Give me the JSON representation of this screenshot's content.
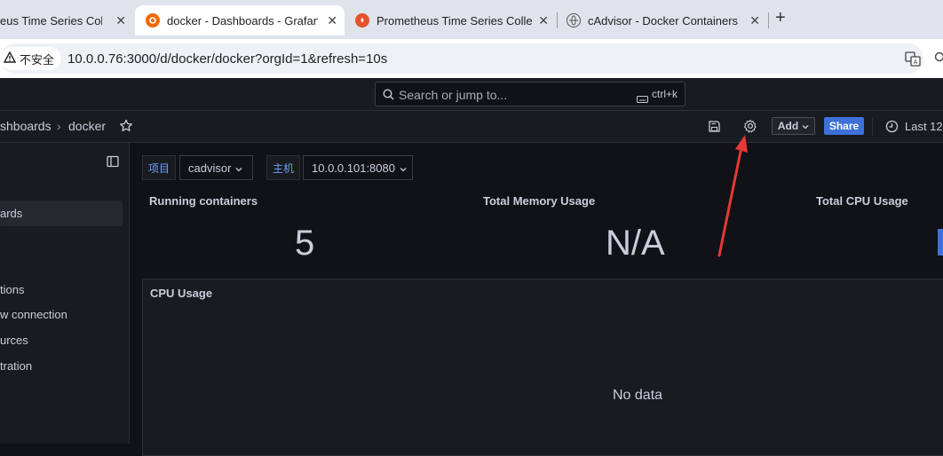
{
  "browser": {
    "tabs": [
      {
        "label": "eus Time Series Colle",
        "active": false
      },
      {
        "label": "docker - Dashboards - Grafan",
        "active": true
      },
      {
        "label": "Prometheus Time Series Colle",
        "active": false
      },
      {
        "label": "cAdvisor - Docker Containers",
        "active": false
      }
    ],
    "new_tab": "+",
    "security_label": "不安全",
    "url": "10.0.0.76:3000/d/docker/docker?orgId=1&refresh=10s"
  },
  "grafana": {
    "search_placeholder": "Search or jump to...",
    "search_shortcut": "ctrl+k",
    "breadcrumb": {
      "parent": "shboards",
      "separator": "›",
      "current": "docker"
    },
    "toolbar": {
      "add_label": "Add",
      "share_label": "Share",
      "time_label": "Last 12"
    },
    "sidebar": {
      "items": [
        {
          "label": "ards",
          "active": true
        },
        {
          "label": "tions",
          "active": false
        },
        {
          "label": "w connection",
          "active": false
        },
        {
          "label": "urces",
          "active": false
        },
        {
          "label": "tration",
          "active": false
        }
      ]
    },
    "variables": [
      {
        "label": "项目",
        "value": "cadvisor"
      },
      {
        "label": "主机",
        "value": "10.0.0.101:8080"
      }
    ],
    "stats": [
      {
        "title": "Running containers",
        "value": "5"
      },
      {
        "title": "Total Memory Usage",
        "value": "N/A"
      },
      {
        "title": "Total CPU Usage",
        "value": ""
      }
    ],
    "panel": {
      "title": "CPU Usage",
      "empty_text": "No data"
    }
  },
  "colors": {
    "accent": "#3d71d9",
    "annotation_arrow": "#e53935"
  }
}
